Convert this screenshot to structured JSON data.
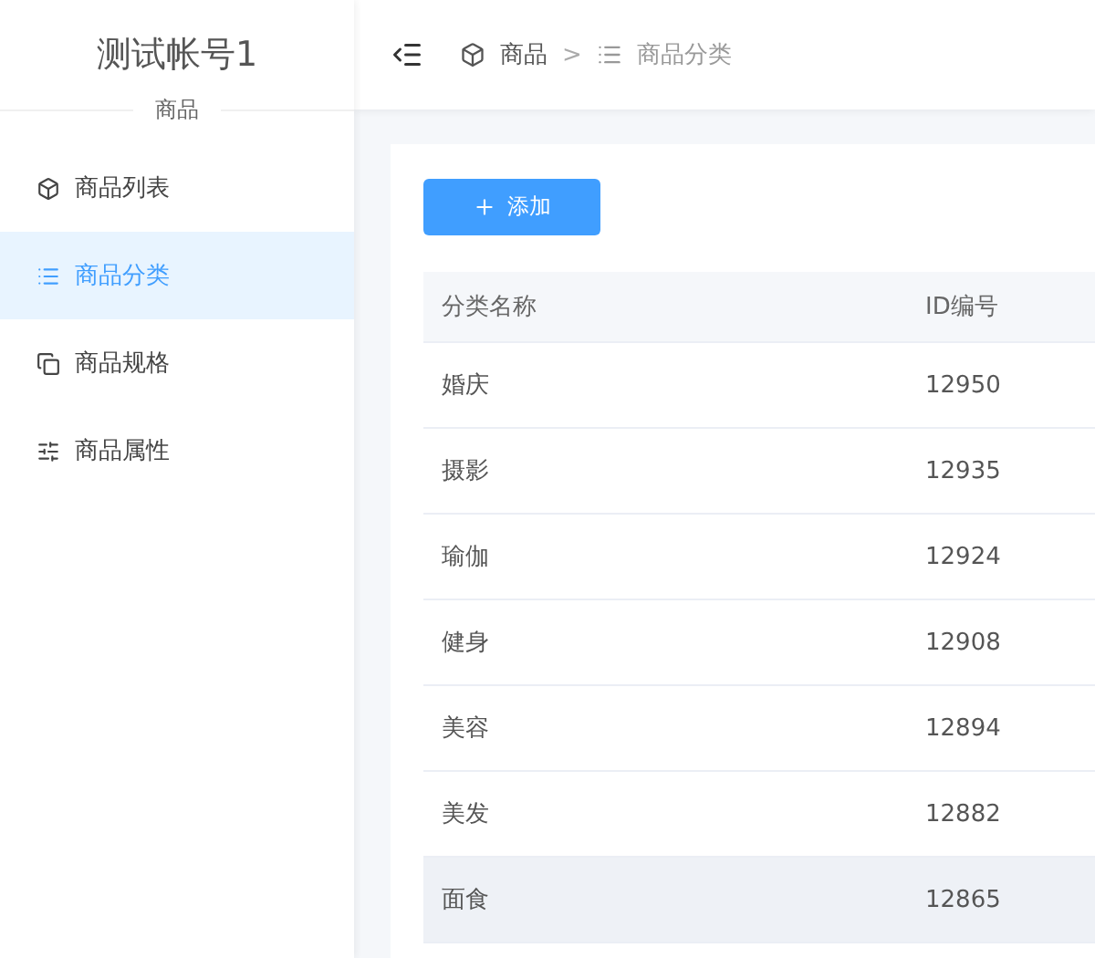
{
  "sidebar": {
    "title": "测试帐号1",
    "subtitle": "商品",
    "items": [
      {
        "label": "商品列表",
        "selected": false
      },
      {
        "label": "商品分类",
        "selected": true
      },
      {
        "label": "商品规格",
        "selected": false
      },
      {
        "label": "商品属性",
        "selected": false
      }
    ]
  },
  "breadcrumb": [
    "商品",
    "商品分类"
  ],
  "breadcrumb_separator": ">",
  "add_button": "添加",
  "table": {
    "columns": [
      "分类名称",
      "ID编号"
    ],
    "rows": [
      {
        "cells": [
          "婚庆",
          "12950"
        ],
        "hovered": false
      },
      {
        "cells": [
          "摄影",
          "12935"
        ],
        "hovered": false
      },
      {
        "cells": [
          "瑜伽",
          "12924"
        ],
        "hovered": false
      },
      {
        "cells": [
          "健身",
          "12908"
        ],
        "hovered": false
      },
      {
        "cells": [
          "美容",
          "12894"
        ],
        "hovered": false
      },
      {
        "cells": [
          "美发",
          "12882"
        ],
        "hovered": false
      },
      {
        "cells": [
          "面食",
          "12865"
        ],
        "hovered": true
      }
    ]
  }
}
